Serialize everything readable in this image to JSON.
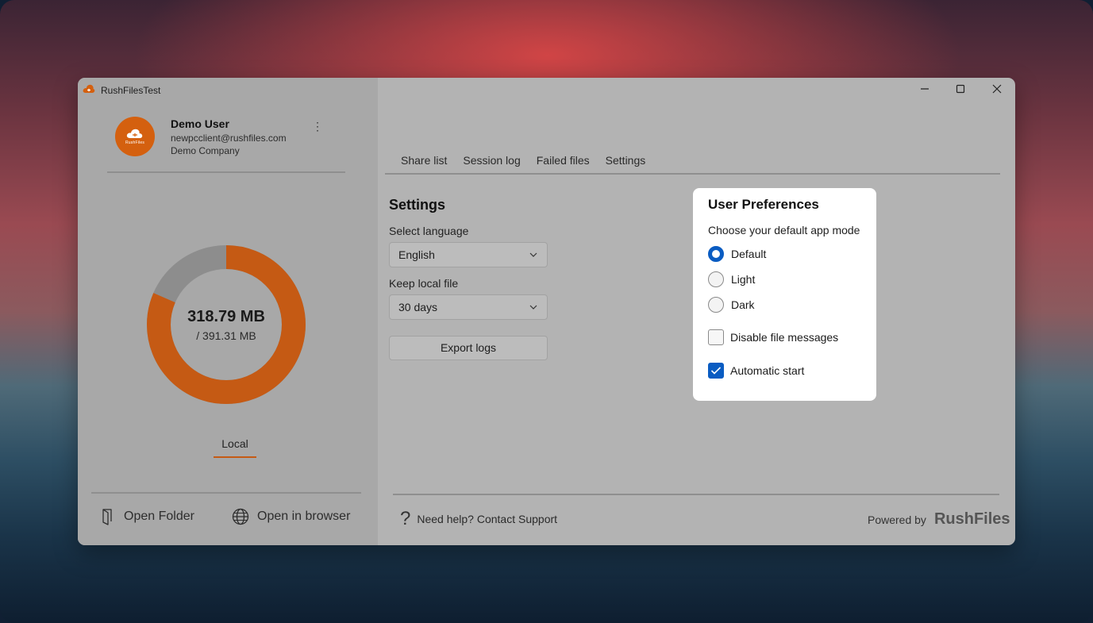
{
  "window": {
    "title": "RushFilesTest"
  },
  "user": {
    "name": "Demo User",
    "email": "newpcclient@rushfiles.com",
    "company": "Demo Company",
    "avatar_text": "RushFiles"
  },
  "storage": {
    "used": "318.79 MB",
    "total": "/ 391.31 MB",
    "used_fraction": 0.815
  },
  "left_tabs": {
    "local": "Local"
  },
  "left_footer": {
    "open_folder": "Open Folder",
    "open_browser": "Open in browser"
  },
  "tabs": [
    {
      "label": "Share list",
      "active": false
    },
    {
      "label": "Session log",
      "active": false
    },
    {
      "label": "Failed files",
      "active": false
    },
    {
      "label": "Settings",
      "active": true
    }
  ],
  "settings": {
    "title": "Settings",
    "language_label": "Select language",
    "language_value": "English",
    "keep_label": "Keep local file",
    "keep_value": "30 days",
    "export_label": "Export logs"
  },
  "preferences": {
    "title": "User Preferences",
    "subtitle": "Choose your default app mode",
    "modes": [
      {
        "label": "Default",
        "selected": true
      },
      {
        "label": "Light",
        "selected": false
      },
      {
        "label": "Dark",
        "selected": false
      }
    ],
    "disable_messages": {
      "label": "Disable file messages",
      "checked": false
    },
    "auto_start": {
      "label": "Automatic start",
      "checked": true
    }
  },
  "footer": {
    "help": "Need help? Contact Support",
    "powered_by": "Powered by",
    "brand": "RushFiles"
  },
  "colors": {
    "accent": "#c55a14",
    "donut_used": "#c55a14",
    "donut_free": "#8d8d8d",
    "selection_blue": "#0a5cc2"
  }
}
